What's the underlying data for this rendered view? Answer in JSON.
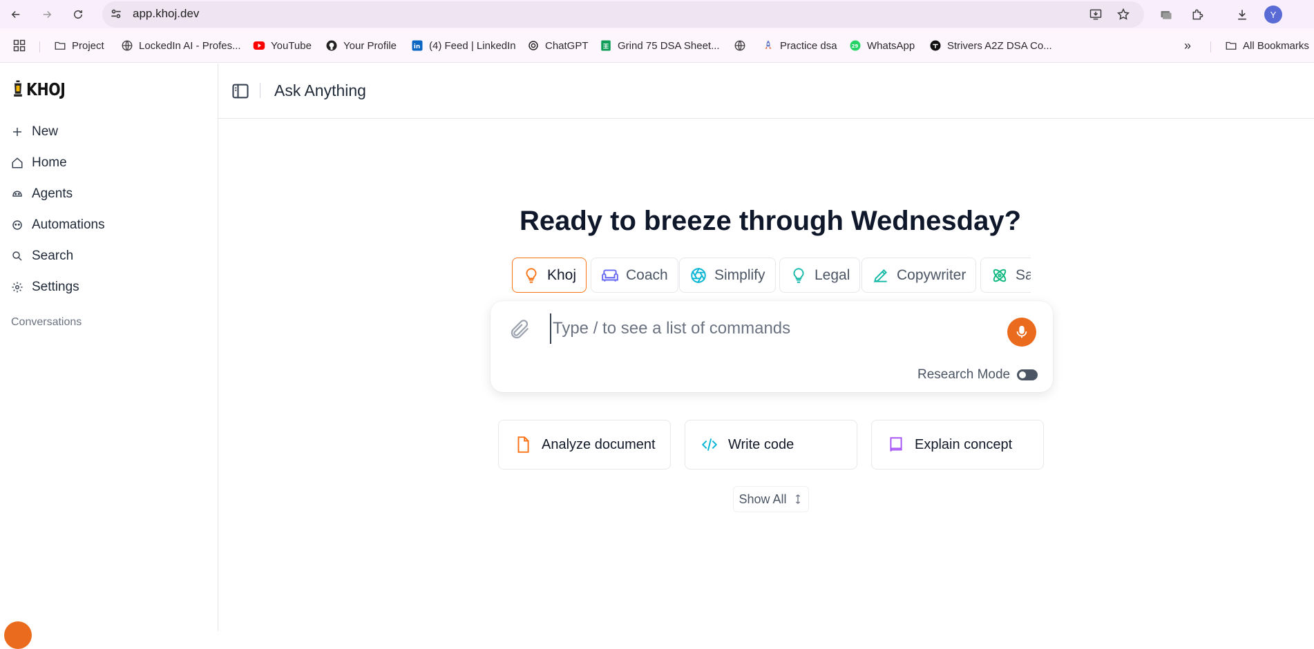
{
  "browser": {
    "url": "app.khoj.dev",
    "profile_initial": "Y",
    "icons": [
      "back-icon",
      "forward-icon",
      "reload-icon",
      "site-info-icon",
      "install-icon",
      "star-icon",
      "tab-search-icon",
      "extensions-icon",
      "downloads-icon"
    ]
  },
  "bookmarks": {
    "items": [
      {
        "label": "Project",
        "icon": "folder-icon"
      },
      {
        "label": "LockedIn AI - Profes...",
        "icon": "globe-icon"
      },
      {
        "label": "YouTube",
        "icon": "youtube-icon",
        "color": "#ff0000"
      },
      {
        "label": "Your Profile",
        "icon": "github-icon"
      },
      {
        "label": "(4) Feed | LinkedIn",
        "icon": "linkedin-icon",
        "color": "#0a66c2"
      },
      {
        "label": "ChatGPT",
        "icon": "chatgpt-icon"
      },
      {
        "label": "Grind 75 DSA Sheet...",
        "icon": "sheet-icon",
        "color": "#0f9d58"
      },
      {
        "label": "",
        "icon": "globe-icon"
      },
      {
        "label": "Practice dsa",
        "icon": "rocket-icon"
      },
      {
        "label": "WhatsApp",
        "icon": "whatsapp-icon",
        "color": "#25d366"
      },
      {
        "label": "Strivers A2Z DSA Co...",
        "icon": "tuf-icon"
      }
    ],
    "overflow": "»",
    "all_bookmarks": "All Bookmarks"
  },
  "sidebar": {
    "logo": "KHOJ",
    "items": [
      {
        "label": "New",
        "icon": "plus-icon"
      },
      {
        "label": "Home",
        "icon": "home-icon"
      },
      {
        "label": "Agents",
        "icon": "agents-icon"
      },
      {
        "label": "Automations",
        "icon": "automations-icon"
      },
      {
        "label": "Search",
        "icon": "search-icon"
      },
      {
        "label": "Settings",
        "icon": "gear-icon"
      }
    ],
    "conversations_label": "Conversations"
  },
  "header": {
    "title": "Ask Anything"
  },
  "main": {
    "greeting": "Ready to breeze through Wednesday?",
    "agents": [
      {
        "label": "Khoj",
        "icon": "lightbulb-icon",
        "color": "#f97316",
        "active": true
      },
      {
        "label": "Coach",
        "icon": "sofa-icon",
        "color": "#6366f1"
      },
      {
        "label": "Simplify",
        "icon": "aperture-icon",
        "color": "#06b6d4"
      },
      {
        "label": "Legal",
        "icon": "lightbulb-icon",
        "color": "#14b8a6"
      },
      {
        "label": "Copywriter",
        "icon": "pencil-icon",
        "color": "#14b8a6"
      },
      {
        "label": "Sa",
        "icon": "atom-icon",
        "color": "#10b981"
      }
    ],
    "input_placeholder": "Type / to see a list of commands",
    "research_mode_label": "Research Mode",
    "research_mode_on": false,
    "accent": "#ea6b1e",
    "suggestions": [
      {
        "label": "Analyze document",
        "icon": "document-icon",
        "color": "#f97316"
      },
      {
        "label": "Write code",
        "icon": "code-icon",
        "color": "#06b6d4"
      },
      {
        "label": "Explain concept",
        "icon": "book-icon",
        "color": "#a855f7"
      }
    ],
    "show_all_label": "Show All"
  }
}
